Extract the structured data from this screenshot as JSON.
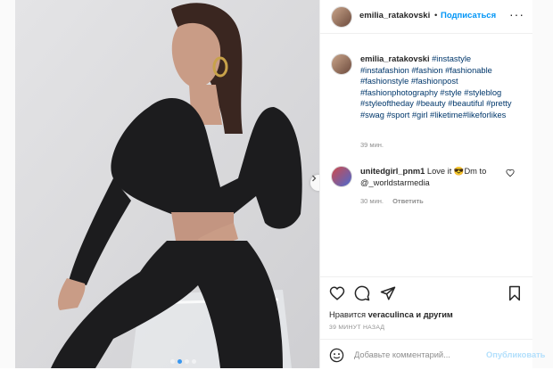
{
  "post": {
    "username": "emilia_ratakovski",
    "follow_dot": "•",
    "follow_label": "Подписаться",
    "more_label": "···",
    "caption_user": "emilia_ratakovski",
    "caption_tags": "#instastyle #instafashion #fashion #fashionable #fashionstyle #fashionpost #fashionphotography #style #styleblog #styleoftheday #beauty #beautiful #pretty #swag #sport #girl #liketime#likeforlikes",
    "caption_time": "39 мин."
  },
  "comment": {
    "username": "unitedgirl_pnm1",
    "text": "Love it 😎Dm to @_worldstarmedia",
    "time": "30 мин.",
    "reply_label": "Ответить"
  },
  "actions": {
    "likes_prefix": "Нравится",
    "likes_user": "veraculinca",
    "likes_suffix": "и другим",
    "time_ago": "39 МИНУТ НАЗАД",
    "comment_placeholder": "Добавьте комментарий...",
    "publish_label": "Опубликовать"
  },
  "carousel": {
    "slide_count": 4,
    "active_index": 1
  },
  "colors": {
    "link": "#0095f6",
    "hashtag": "#00376b",
    "muted": "#8e8e8e",
    "publish_disabled": "#b2dffc"
  },
  "icons": [
    "photo",
    "next-arrow-icon",
    "more-options-icon",
    "heart-icon",
    "comment-icon",
    "share-icon",
    "bookmark-icon",
    "emoji-icon"
  ]
}
